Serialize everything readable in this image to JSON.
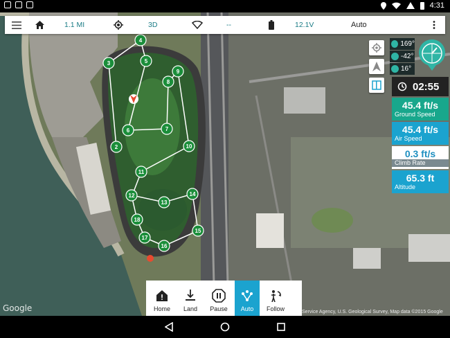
{
  "toolbar": {
    "distance": "1.1 MI",
    "gps_fix": "3D",
    "signal": "--",
    "battery": "12.1V",
    "mode": "Auto"
  },
  "attitude": {
    "yaw": "169°",
    "pitch": "-42°",
    "roll": "16°"
  },
  "telemetry": {
    "flight_time": "02:55",
    "ground_speed_value": "45.4 ft/s",
    "ground_speed_label": "Ground Speed",
    "air_speed_value": "45.4 ft/s",
    "air_speed_label": "Air Speed",
    "climb_rate_value": "0.3 ft/s",
    "climb_rate_label": "Climb Rate",
    "altitude_value": "65.3 ft",
    "altitude_label": "Altitude"
  },
  "waypoints": [
    "2",
    "3",
    "4",
    "5",
    "6",
    "7",
    "8",
    "9",
    "10",
    "11",
    "12",
    "13",
    "14",
    "15",
    "16",
    "17",
    "18"
  ],
  "actions": {
    "home": "Home",
    "land": "Land",
    "pause": "Pause",
    "auto": "Auto",
    "follow": "Follow"
  },
  "map": {
    "logo": "Google",
    "credit": "Service Agency, U.S. Geological Survey, Map data ©2015 Google"
  },
  "status_bar": {
    "time": "4:31"
  },
  "colors": {
    "accent": "#1ba3cf",
    "ground_speed": "#18a78c",
    "waypoint": "#1b8e3a"
  }
}
